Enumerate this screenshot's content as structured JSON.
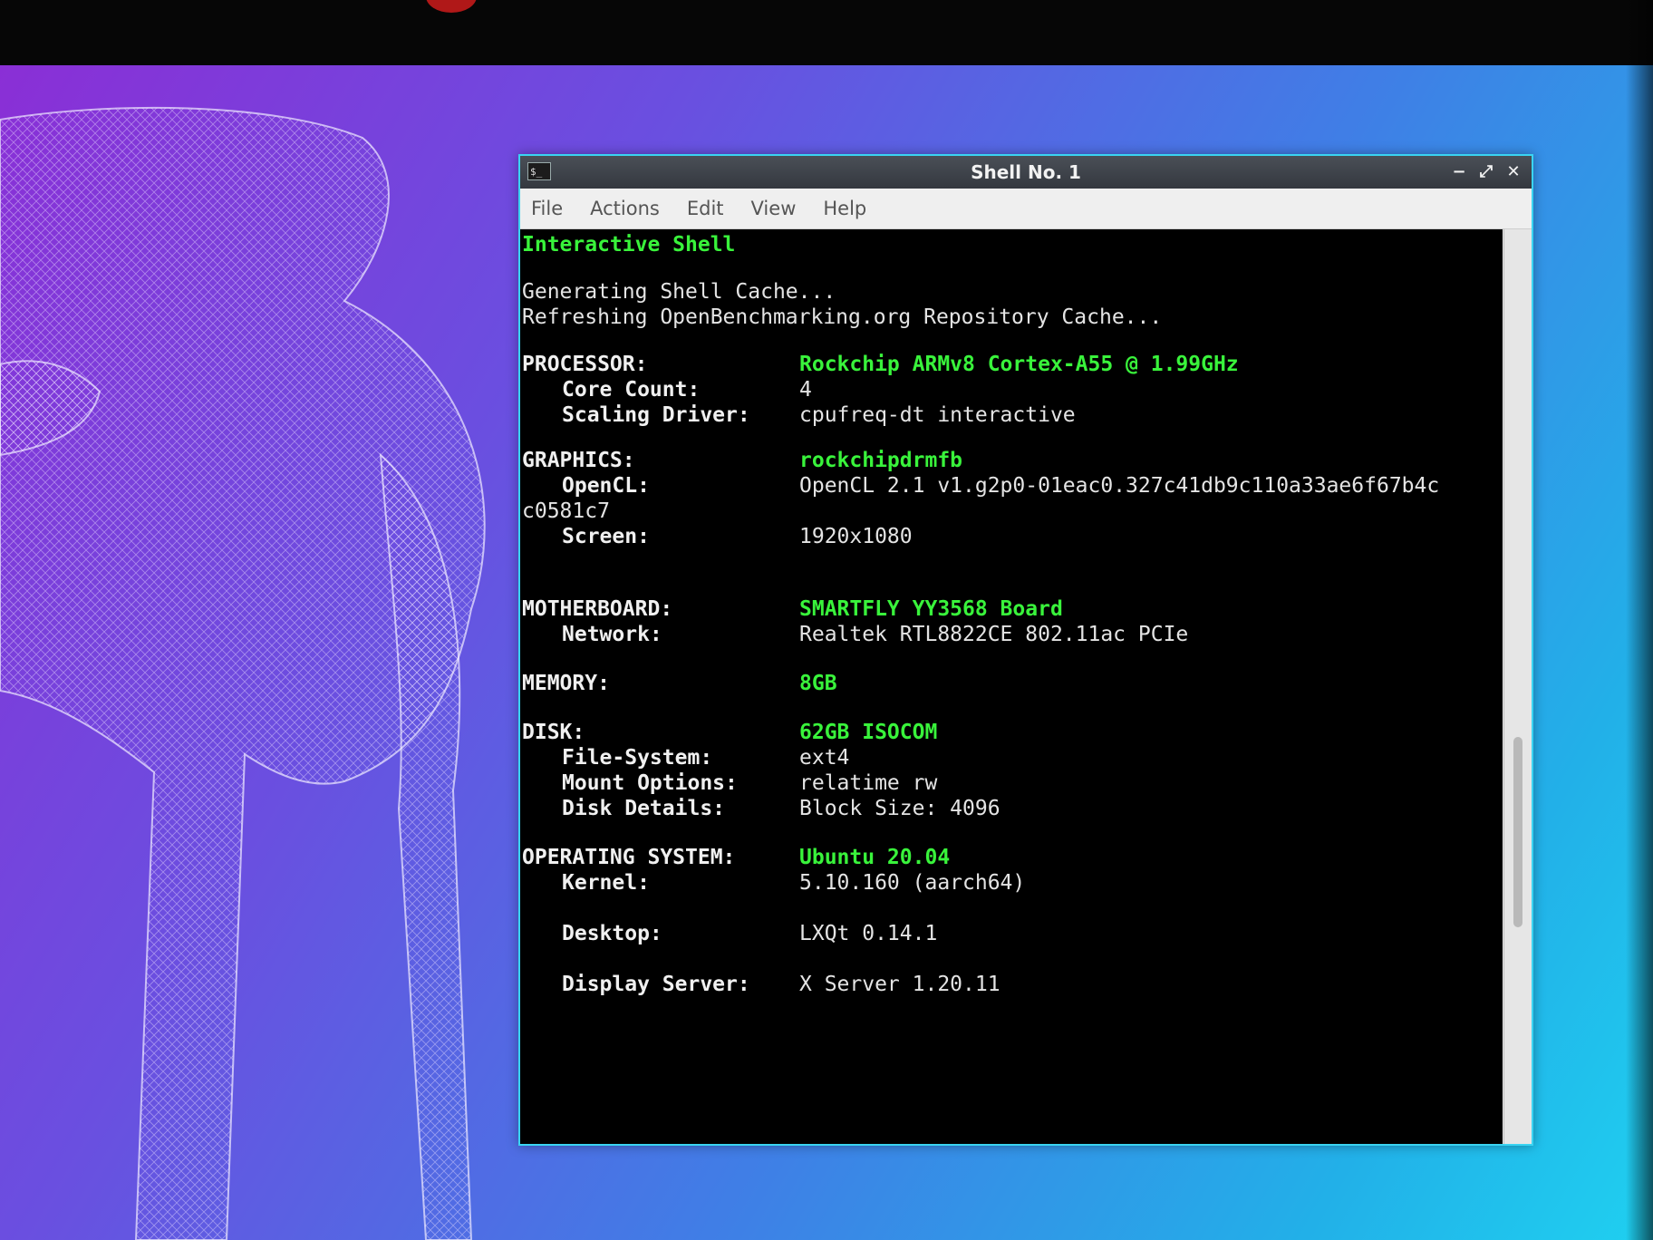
{
  "window": {
    "title": "Shell No. 1",
    "icon": "terminal-icon",
    "controls": {
      "minimize": "−",
      "maximize": "⤢",
      "close": "✕"
    }
  },
  "menu": [
    "File",
    "Actions",
    "Edit",
    "View",
    "Help"
  ],
  "terminal": {
    "header": "Interactive Shell",
    "status_lines": [
      "Generating Shell Cache...",
      "Refreshing OpenBenchmarking.org Repository Cache..."
    ],
    "processor": {
      "label": "PROCESSOR:",
      "value": "Rockchip ARMv8 Cortex-A55 @ 1.99GHz",
      "core_count_label": "Core Count:",
      "core_count": "4",
      "scaling_driver_label": "Scaling Driver:",
      "scaling_driver": "cpufreq-dt interactive"
    },
    "graphics": {
      "label": "GRAPHICS:",
      "value": "rockchipdrmfb",
      "opencl_label": "OpenCL:",
      "opencl": "OpenCL 2.1 v1.g2p0-01eac0.327c41db9c110a33ae6f67b4c",
      "opencl_wrap": "c0581c7",
      "screen_label": "Screen:",
      "screen": "1920x1080"
    },
    "motherboard": {
      "label": "MOTHERBOARD:",
      "value": "SMARTFLY YY3568 Board",
      "network_label": "Network:",
      "network": "Realtek RTL8822CE 802.11ac PCIe"
    },
    "memory": {
      "label": "MEMORY:",
      "value": "8GB"
    },
    "disk": {
      "label": "DISK:",
      "value": "62GB ISOCOM",
      "filesystem_label": "File-System:",
      "filesystem": "ext4",
      "mount_label": "Mount Options:",
      "mount": "relatime rw",
      "details_label": "Disk Details:",
      "details": "Block Size: 4096"
    },
    "os": {
      "label": "OPERATING SYSTEM:",
      "value": "Ubuntu 20.04",
      "kernel_label": "Kernel:",
      "kernel": "5.10.160 (aarch64)",
      "desktop_label": "Desktop:",
      "desktop": "LXQt 0.14.1",
      "display_label": "Display Server:",
      "display": "X Server 1.20.11"
    }
  }
}
